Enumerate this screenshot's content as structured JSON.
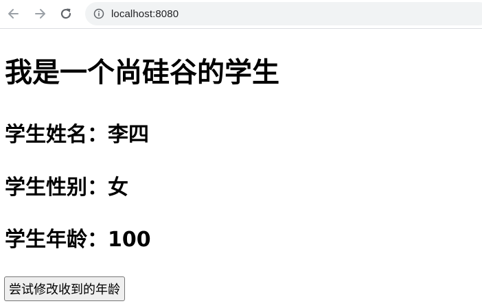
{
  "browser": {
    "url": "localhost:8080",
    "icons": {
      "back": "arrow-left-icon",
      "forward": "arrow-right-icon",
      "reload": "reload-icon",
      "info": "info-icon"
    }
  },
  "page": {
    "heading": "我是一个尚硅谷的学生",
    "student_name_line": "学生姓名：李四",
    "student_gender_line": "学生性别：女",
    "student_age_line": "学生年龄：100",
    "button_label": "尝试修改收到的年龄"
  }
}
